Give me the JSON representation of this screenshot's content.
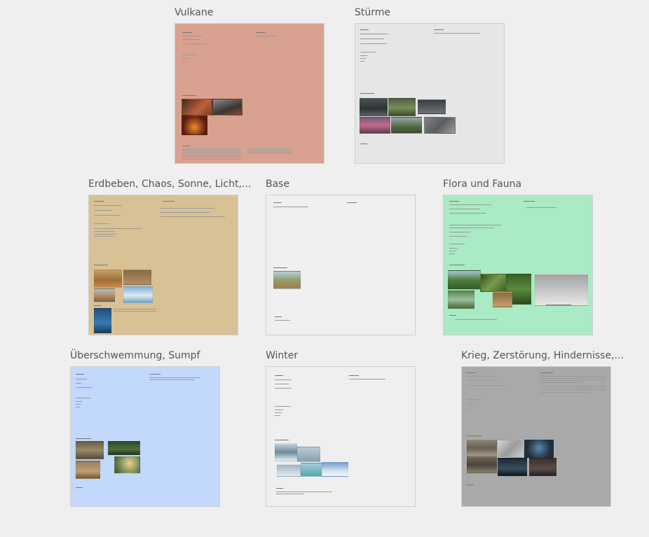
{
  "frames": [
    {
      "id": "vulkane",
      "title": "Vulkane",
      "bg": "#d9a18f"
    },
    {
      "id": "stuerme",
      "title": "Stürme",
      "bg": "#e6e6e6"
    },
    {
      "id": "erdbeben",
      "title": "Erdbeben, Chaos, Sonne, Licht,...",
      "bg": "#d8c194"
    },
    {
      "id": "base",
      "title": "Base",
      "bg": "#f0f0f0"
    },
    {
      "id": "flora",
      "title": "Flora und Fauna",
      "bg": "#aaeac4"
    },
    {
      "id": "ueberschwemmung",
      "title": "Überschwemmung, Sumpf",
      "bg": "#c2d8fc"
    },
    {
      "id": "winter",
      "title": "Winter",
      "bg": "#efefef"
    },
    {
      "id": "krieg",
      "title": "Krieg, Zerstörung, Hindernisse,...",
      "bg": "#a9a9a9"
    }
  ]
}
